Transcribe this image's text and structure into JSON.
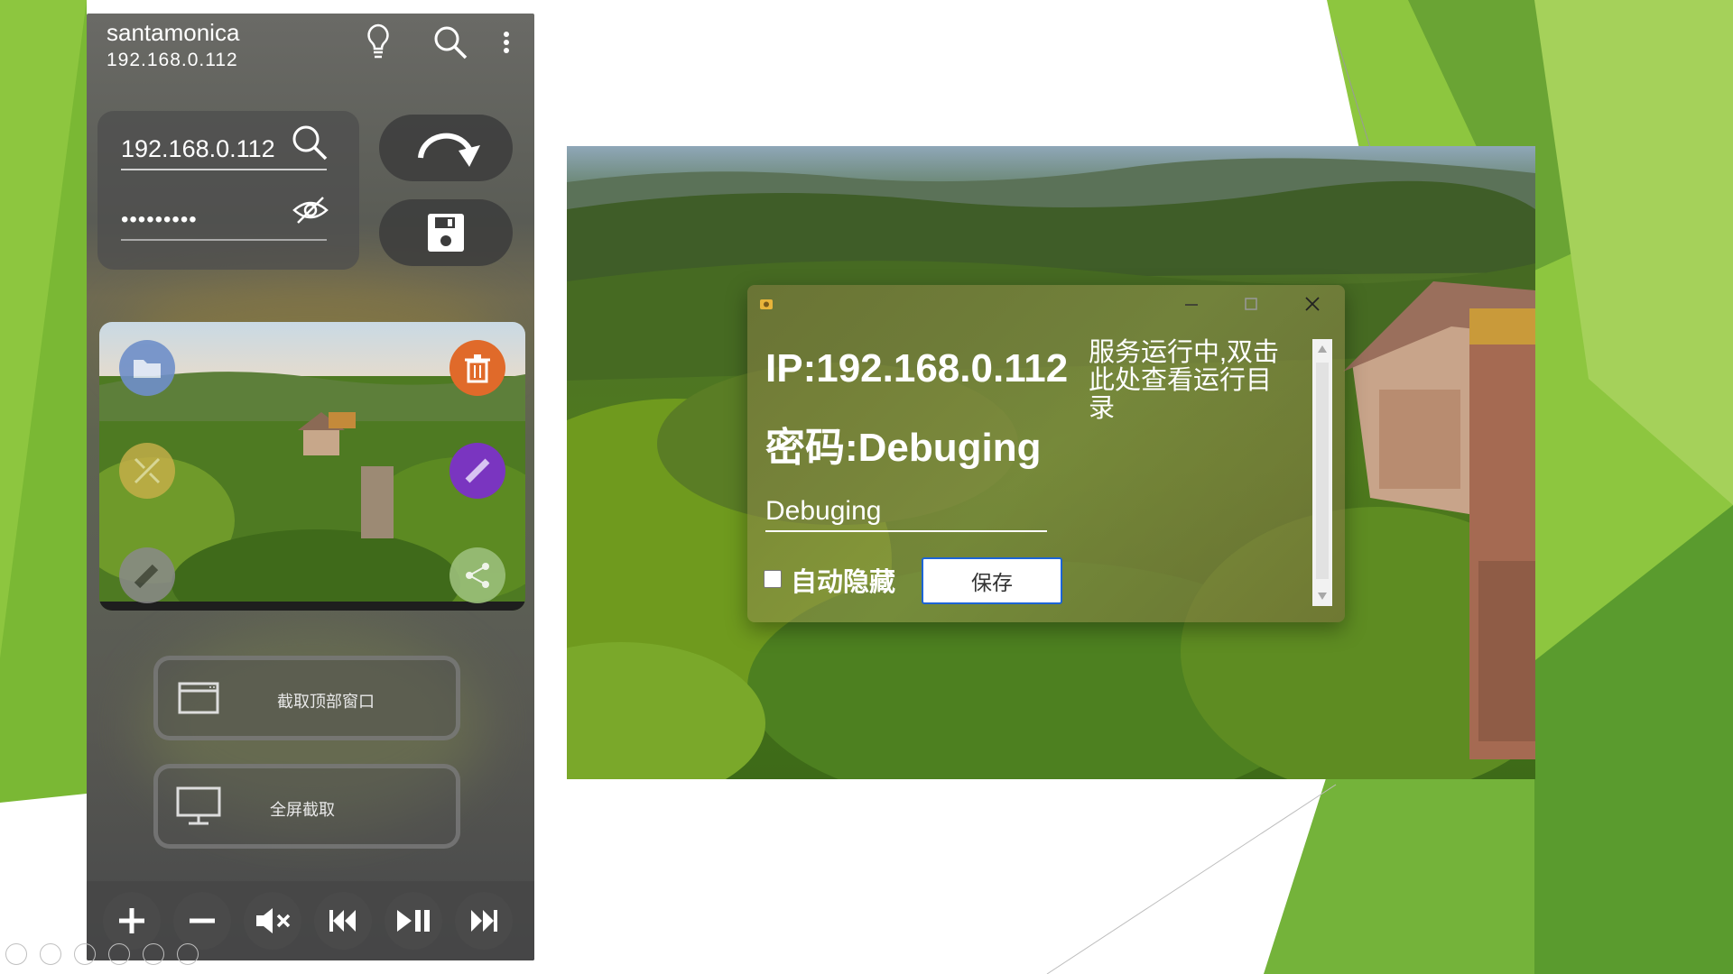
{
  "phone": {
    "device_name": "santamonica",
    "device_ip": "192.168.0.112",
    "ip_field_value": "192.168.0.112",
    "password_field_value": "•••••••••",
    "capture_top_window_label": "截取顶部窗口",
    "fullscreen_capture_label": "全屏截取"
  },
  "dialog": {
    "ip_text": "IP:192.168.0.112",
    "password_text": "密码:Debuging",
    "password_input_value": "Debuging",
    "auto_hide_label": "自动隐藏",
    "save_label": "保存",
    "status_text": "服务运行中,双击此处查看运行目录"
  },
  "colors": {
    "slide_green": "#8dc63f",
    "slide_green_dark": "#5a9b2e",
    "dialog_button_border": "#1c64d6",
    "fab_blue": "#6f8fc9",
    "fab_orange": "#e06a2a",
    "fab_yellow": "#c9b04a",
    "fab_purple": "#7a35c0",
    "fab_grey": "#8a8a8a",
    "fab_green": "#9bbf7a"
  },
  "icons": {
    "top_bar": [
      "lightbulb-icon",
      "search-icon",
      "more-vertical-icon"
    ],
    "thumbnail": [
      "folder-icon",
      "trash-icon",
      "collapse-icon",
      "pencil-icon",
      "flashlight-icon",
      "share-icon"
    ],
    "controls": [
      "plus-icon",
      "minus-icon",
      "mute-icon",
      "previous-track-icon",
      "play-pause-icon",
      "next-track-icon"
    ]
  }
}
